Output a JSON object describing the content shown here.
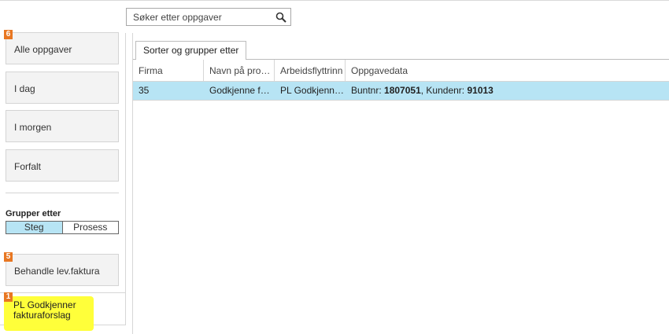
{
  "search": {
    "placeholder": "Søker etter oppgaver"
  },
  "sidebar": {
    "cards": [
      {
        "label": "Alle oppgaver",
        "badge": "6"
      },
      {
        "label": "I dag"
      },
      {
        "label": "I morgen"
      },
      {
        "label": "Forfalt"
      }
    ],
    "group_by": {
      "label": "Grupper etter",
      "options": [
        "Steg",
        "Prosess"
      ],
      "selected": "Steg"
    },
    "groups": [
      {
        "label": "Behandle lev.faktura",
        "badge": "5"
      },
      {
        "label": "PL Godkjenner fakturaforslag",
        "badge": "1",
        "selected": true
      }
    ]
  },
  "main": {
    "tab_label": "Sorter og grupper etter",
    "columns": [
      "Firma",
      "Navn på prose…",
      "Arbeidsflyttrinn",
      "Oppgavedata"
    ],
    "rows": [
      {
        "firma": "35",
        "navn": "Godkjenne fa…",
        "trinn": "PL Godkjenne…",
        "data_buntnr_label": "Buntnr: ",
        "data_buntnr": "1807051",
        "data_kunde_label": ", Kundenr: ",
        "data_kunde": "91013"
      }
    ]
  },
  "colors": {
    "badge": "#e87722",
    "selected_row": "#b7e4f4",
    "highlight": "#ffff3a"
  }
}
